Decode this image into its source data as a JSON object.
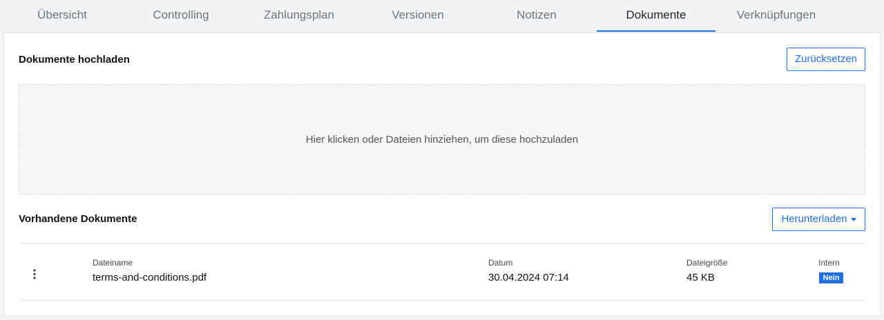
{
  "tabs": [
    {
      "label": "Übersicht"
    },
    {
      "label": "Controlling"
    },
    {
      "label": "Zahlungsplan"
    },
    {
      "label": "Versionen"
    },
    {
      "label": "Notizen"
    },
    {
      "label": "Dokumente",
      "active": true
    },
    {
      "label": "Verknüpfungen"
    }
  ],
  "upload": {
    "title": "Dokumente hochladen",
    "reset_label": "Zurücksetzen",
    "dropzone_text": "Hier klicken oder Dateien hinziehen, um diese hochzuladen"
  },
  "documents": {
    "title": "Vorhandene Dokumente",
    "download_label": "Herunterladen",
    "columns": {
      "filename": "Dateiname",
      "date": "Datum",
      "size": "Dateigröße",
      "internal": "Intern"
    },
    "rows": [
      {
        "filename": "terms-and-conditions.pdf",
        "date": "30.04.2024 07:14",
        "size": "45 KB",
        "internal": "Nein"
      }
    ]
  },
  "colors": {
    "accent": "#1f6fe5",
    "panel_bg": "#ffffff",
    "page_bg": "#f3f4f6"
  },
  "icons": {
    "row_menu": "kebab-menu-icon",
    "dropdown": "caret-down-icon"
  }
}
